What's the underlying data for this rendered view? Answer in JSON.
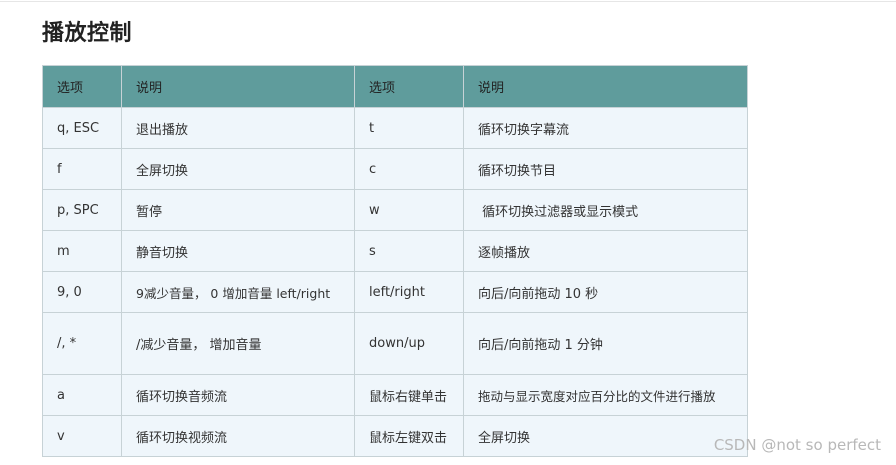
{
  "heading": "播放控制",
  "table": {
    "headers": [
      "选项",
      "说明",
      "选项",
      "说明"
    ],
    "rows": [
      [
        "q, ESC",
        "退出播放",
        "t",
        "循环切换字幕流"
      ],
      [
        "f",
        "全屏切换",
        "c",
        "循环切换节目"
      ],
      [
        "p, SPC",
        "暂停",
        "w",
        " 循环切换过滤器或显示模式"
      ],
      [
        "m",
        "静音切换",
        "s",
        "逐帧播放"
      ],
      [
        "9, 0",
        "9减少音量， 0 增加音量 left/right",
        "left/right",
        "向后/向前拖动 10 秒"
      ],
      [
        "/, *",
        "/减少音量， 增加音量",
        "down/up",
        "向后/向前拖动 1 分钟"
      ],
      [
        "a",
        "循环切换音频流",
        "鼠标右键单击",
        "拖动与显示宽度对应百分比的文件进行播放"
      ],
      [
        "v",
        "循环切换视频流",
        "鼠标左键双击",
        "全屏切换"
      ]
    ]
  },
  "watermark": "CSDN @not  so perfect"
}
